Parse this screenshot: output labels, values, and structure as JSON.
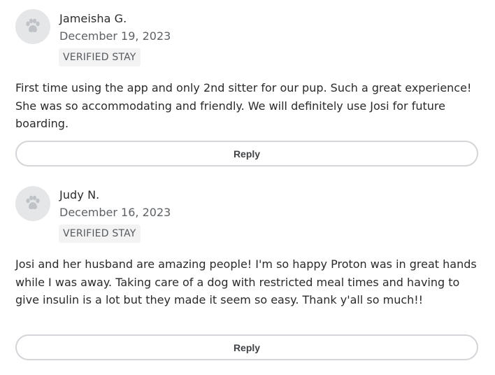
{
  "reviews": [
    {
      "avatar_icon": "paw-icon",
      "name": "Jameisha G.",
      "date": "December 19, 2023",
      "badge": "VERIFIED STAY",
      "text": "First time using the app and only 2nd sitter for our pup. Such a great experience! She was so accommodating and friendly. We will definitely use Josi for future boarding.",
      "reply_label": "Reply"
    },
    {
      "avatar_icon": "paw-icon",
      "name": "Judy N.",
      "date": "December 16, 2023",
      "badge": "VERIFIED STAY",
      "text": "Josi and her husband are amazing people! I'm so happy Proton was in great hands while I was away. Taking care of a dog with restricted meal times and having to give insulin is a lot but they made it seem so easy. Thank y'all so much!!",
      "reply_label": "Reply"
    }
  ],
  "colors": {
    "avatar_bg": "#e5e6e8",
    "paw": "#bfc2c6",
    "badge_bg": "#f3f3f3",
    "button_border": "#d3d5d8"
  }
}
